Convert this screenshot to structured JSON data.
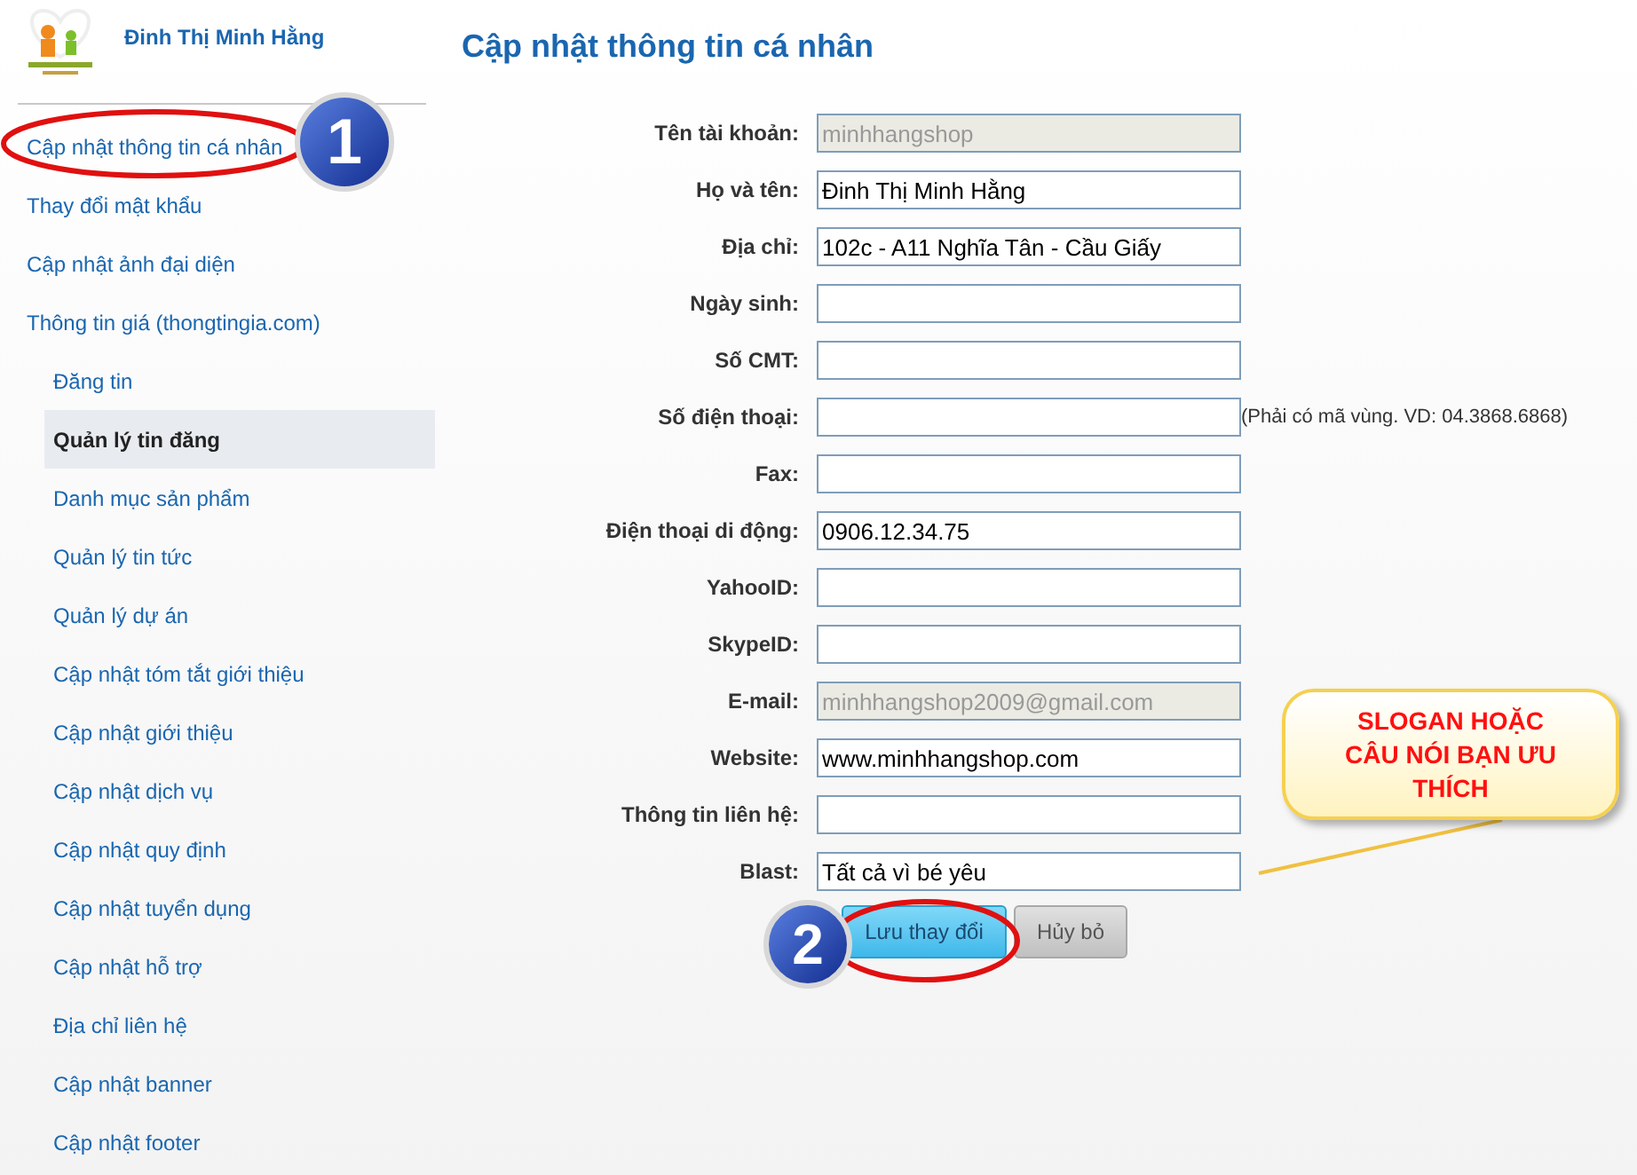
{
  "sidebar": {
    "user_name": "Đinh Thị Minh Hằng",
    "items": [
      {
        "label": "Cập nhật thông tin cá nhân",
        "selected": false
      },
      {
        "label": "Thay đổi mật khẩu",
        "selected": false
      },
      {
        "label": "Cập nhật ảnh đại diện",
        "selected": false
      },
      {
        "label": "Thông tin giá (thongtingia.com)",
        "selected": false,
        "children": [
          {
            "label": "Đăng tin",
            "selected": false
          },
          {
            "label": "Quản lý tin đăng",
            "selected": true
          },
          {
            "label": "Danh mục sản phẩm",
            "selected": false
          },
          {
            "label": "Quản lý tin tức",
            "selected": false
          },
          {
            "label": "Quản lý dự án",
            "selected": false
          },
          {
            "label": "Cập nhật tóm tắt giới thiệu",
            "selected": false
          },
          {
            "label": "Cập nhật giới thiệu",
            "selected": false
          },
          {
            "label": "Cập nhật dịch vụ",
            "selected": false
          },
          {
            "label": "Cập nhật quy định",
            "selected": false
          },
          {
            "label": "Cập nhật tuyển dụng",
            "selected": false
          },
          {
            "label": "Cập nhật hỗ trợ",
            "selected": false
          },
          {
            "label": "Địa chỉ liên hệ",
            "selected": false
          },
          {
            "label": "Cập nhật banner",
            "selected": false
          },
          {
            "label": "Cập nhật footer",
            "selected": false
          }
        ]
      }
    ]
  },
  "form": {
    "title": "Cập nhật thông tin cá nhân",
    "fields": [
      {
        "label": "Tên tài khoản:",
        "value": "minhhangshop",
        "disabled": true
      },
      {
        "label": "Họ và tên:",
        "value": "Đinh Thị Minh Hằng",
        "disabled": false
      },
      {
        "label": "Địa chỉ:",
        "value": "102c - A11 Nghĩa Tân - Cầu Giấy",
        "disabled": false
      },
      {
        "label": "Ngày sinh:",
        "disabled": false
      },
      {
        "label": "Số CMT:",
        "disabled": false
      },
      {
        "label": "Số điện thoại:",
        "disabled": false,
        "hint": "(Phải có mã vùng. VD: 04.3868.6868)"
      },
      {
        "label": "Fax:",
        "disabled": false
      },
      {
        "label": "Điện thoại di động:",
        "value": "0906.12.34.75",
        "disabled": false
      },
      {
        "label": "YahooID:",
        "disabled": false
      },
      {
        "label": "SkypeID:",
        "disabled": false
      },
      {
        "label": "E-mail:",
        "value": "minhhangshop2009@gmail.com",
        "disabled": true
      },
      {
        "label": "Website:",
        "value": "www.minhhangshop.com",
        "disabled": false
      },
      {
        "label": "Thông tin liên hệ:",
        "disabled": false
      },
      {
        "label": "Blast:",
        "value": "Tất cả vì bé yêu",
        "disabled": false
      }
    ],
    "buttons": [
      {
        "label": "Lưu thay đổi",
        "kind": "primary"
      },
      {
        "label": "Hủy bỏ",
        "kind": "secondary"
      }
    ]
  },
  "annotations": {
    "badges": [
      "1",
      "2"
    ],
    "callout": "SLOGAN HOẶC CÂU NÓI BẠN ƯU THÍCH"
  }
}
